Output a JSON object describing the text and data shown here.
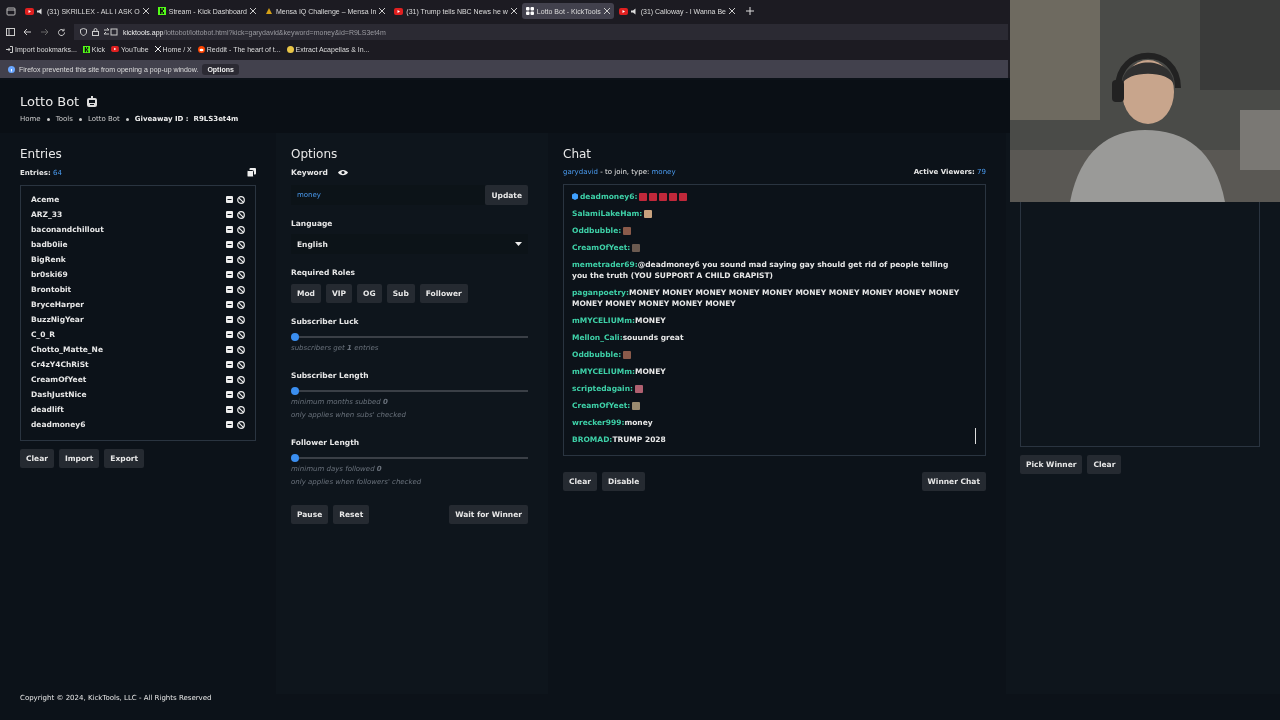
{
  "browser": {
    "tabs": [
      {
        "kind": "youtube",
        "title": "(31) SKRILLEX - ALL I ASK O",
        "audio": true,
        "selected": false
      },
      {
        "kind": "kick",
        "title": "Stream - Kick Dashboard",
        "audio": false,
        "selected": false
      },
      {
        "kind": "mensa",
        "title": "Mensa IQ Challenge – Mensa In",
        "audio": false,
        "selected": false
      },
      {
        "kind": "youtube",
        "title": "(31) Trump tells NBC News he w",
        "audio": false,
        "selected": false
      },
      {
        "kind": "kicktools",
        "title": "Lotto Bot - KickTools",
        "audio": false,
        "selected": true
      },
      {
        "kind": "youtube",
        "title": "(31) Calloway - I Wanna Be",
        "audio": true,
        "selected": false
      }
    ],
    "url_host": "kicktools.app",
    "url_path": "/lottobot/lottobot.html?kick=garydavid&keyword=money&id=R9LS3et4m",
    "bookmarks": [
      {
        "kind": "import",
        "label": "Import bookmarks..."
      },
      {
        "kind": "kick",
        "label": "Kick"
      },
      {
        "kind": "youtube",
        "label": "YouTube"
      },
      {
        "kind": "x",
        "label": "Home / X"
      },
      {
        "kind": "reddit",
        "label": "Reddit - The heart of t..."
      },
      {
        "kind": "folder",
        "label": "Extract Acapellas & In..."
      }
    ],
    "notification": {
      "text": "Firefox prevented this site from opening a pop-up window.",
      "button": "Options"
    }
  },
  "page": {
    "title": "Lotto Bot",
    "breadcrumb": [
      "Home",
      "Tools",
      "Lotto Bot"
    ],
    "giveaway_label": "Giveaway ID :",
    "giveaway_id": "R9LS3et4m"
  },
  "entries": {
    "heading": "Entries",
    "count_label": "Entries:",
    "count": "64",
    "names": [
      "Aceme",
      "ARZ_33",
      "baconandchillout",
      "badb0iie",
      "BigRenk",
      "br0ski69",
      "Brontobit",
      "BryceHarper",
      "BuzzNigYear",
      "C_0_R",
      "Chotto_Matte_Ne",
      "Cr4zY4ChRiSt",
      "CreamOfYeet",
      "DashJustNice",
      "deadlift",
      "deadmoney6"
    ],
    "buttons": [
      "Clear",
      "Import",
      "Export"
    ]
  },
  "options": {
    "heading": "Options",
    "keyword_label": "Keyword",
    "keyword": "money",
    "update": "Update",
    "language_label": "Language",
    "language": "English",
    "roles_label": "Required Roles",
    "roles": [
      {
        "label": "Mod",
        "selected": false
      },
      {
        "label": "VIP",
        "selected": false
      },
      {
        "label": "OG",
        "selected": false
      },
      {
        "label": "Sub",
        "selected": false
      },
      {
        "label": "Follower",
        "selected": false
      }
    ],
    "sliders": [
      {
        "label": "Subscriber Luck",
        "level": 0,
        "notes": [
          "subscribers get **1** entries"
        ]
      },
      {
        "label": "Subscriber Length",
        "level": 0,
        "notes": [
          "minimum months subbed **0**",
          "only applies when subs' checked"
        ]
      },
      {
        "label": "Follower Length",
        "level": 0,
        "notes": [
          "minimum days followed **0**",
          "only applies when followers' checked"
        ]
      }
    ],
    "buttons": [
      "Pause",
      "Reset"
    ],
    "wait_button": "Wait for Winner"
  },
  "chat": {
    "heading": "Chat",
    "channel": "garydavid",
    "join_text": "- to join, type:",
    "keyword": "money",
    "viewers_label": "Active Viewers:",
    "viewers": "79",
    "messages": [
      {
        "user": "deadmoney6:",
        "badge": true,
        "emotes": [
          {
            "color": "#c0283a"
          },
          {
            "color": "#c0283a"
          },
          {
            "color": "#c0283a"
          },
          {
            "color": "#c0283a"
          },
          {
            "color": "#c0283a"
          }
        ]
      },
      {
        "user": "SalamiLakeHam:",
        "badge": false,
        "emotes": [
          {
            "color": "#c9a27e"
          }
        ]
      },
      {
        "user": "Oddbubble:",
        "badge": false,
        "emotes": [
          {
            "color": "#8a5a4a"
          }
        ]
      },
      {
        "user": "CreamOfYeet:",
        "badge": false,
        "emotes": [
          {
            "color": "#6b5a50"
          }
        ]
      },
      {
        "user": "memetrader69:",
        "badge": false,
        "text": "@deadmoney6 you sound mad saying gay should get rid of people telling you the truth (YOU SUPPORT A CHILD GRAPIST)"
      },
      {
        "user": "paganpoetry:",
        "badge": false,
        "text": "MONEY MONEY MONEY MONEY MONEY MONEY MONEY MONEY MONEY MONEY MONEY MONEY MONEY MONEY MONEY"
      },
      {
        "user": "mMYCELIUMm:",
        "badge": false,
        "text": "MONEY"
      },
      {
        "user": "Mellon_Cali:",
        "badge": false,
        "text": "souunds great"
      },
      {
        "user": "Oddbubble:",
        "badge": false,
        "emotes": [
          {
            "color": "#8a5a4a"
          }
        ]
      },
      {
        "user": "mMYCELIUMm:",
        "badge": false,
        "text": "MONEY"
      },
      {
        "user": "scriptedagain:",
        "badge": false,
        "emotes": [
          {
            "color": "#b06070"
          }
        ]
      },
      {
        "user": "CreamOfYeet:",
        "badge": false,
        "emotes": [
          {
            "color": "#9a8a70"
          }
        ]
      },
      {
        "user": "wrecker999:",
        "badge": false,
        "text": "money"
      },
      {
        "user": "BROMAD:",
        "badge": false,
        "text": "TRUMP 2028"
      }
    ],
    "buttons": [
      "Clear",
      "Disable"
    ],
    "winner_button": "Winner Chat"
  },
  "winner": {
    "buttons": [
      "Pick Winner",
      "Clear"
    ]
  },
  "footer": "Copyright © 2024, KickTools, LLC - All Rights Reserved"
}
